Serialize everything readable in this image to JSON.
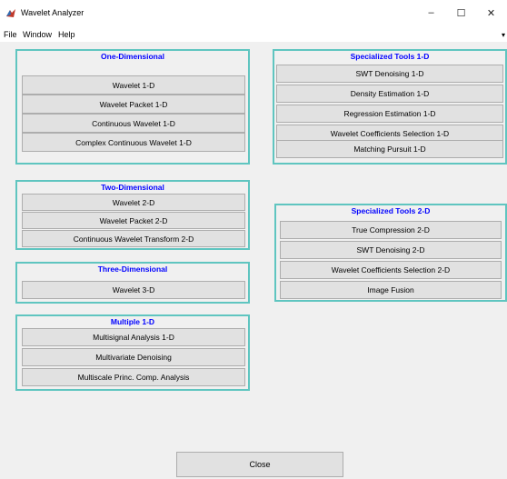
{
  "window": {
    "title": "Wavelet Analyzer",
    "minimize_label": "–",
    "maximize_label": "☐",
    "close_label": "✕"
  },
  "menu": {
    "items": [
      {
        "label": "File"
      },
      {
        "label": "Window"
      },
      {
        "label": "Help"
      }
    ],
    "overflow_label": "▾"
  },
  "panels": {
    "one_dimensional": {
      "title": "One-Dimensional",
      "buttons": [
        "Wavelet 1-D",
        "Wavelet Packet 1-D",
        "Continuous Wavelet 1-D",
        "Complex Continuous Wavelet 1-D"
      ]
    },
    "two_dimensional": {
      "title": "Two-Dimensional",
      "buttons": [
        "Wavelet 2-D",
        "Wavelet Packet 2-D",
        "Continuous Wavelet Transform 2-D"
      ]
    },
    "three_dimensional": {
      "title": "Three-Dimensional",
      "buttons": [
        "Wavelet 3-D"
      ]
    },
    "multiple_1d": {
      "title": "Multiple 1-D",
      "buttons": [
        "Multisignal Analysis 1-D",
        "Multivariate Denoising",
        "Multiscale Princ. Comp. Analysis"
      ]
    },
    "specialized_1d": {
      "title": "Specialized Tools 1-D",
      "buttons": [
        "SWT Denoising 1-D",
        "Density Estimation 1-D",
        "Regression Estimation 1-D",
        "Wavelet Coefficients Selection 1-D",
        "Matching Pursuit 1-D"
      ]
    },
    "specialized_2d": {
      "title": "Specialized Tools 2-D",
      "buttons": [
        "True Compression 2-D",
        "SWT Denoising 2-D",
        "Wavelet Coefficients Selection 2-D",
        "Image Fusion"
      ]
    }
  },
  "footer": {
    "close_label": "Close"
  },
  "colors": {
    "panel_border": "#5fc5c0",
    "panel_title": "#0000ff",
    "button_face": "#e1e1e1"
  }
}
